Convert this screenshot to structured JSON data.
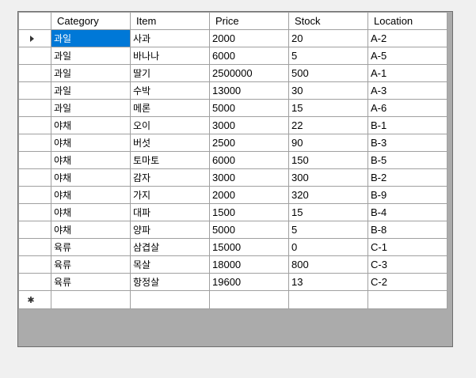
{
  "columns": [
    "Category",
    "Item",
    "Price",
    "Stock",
    "Location"
  ],
  "rows": [
    [
      "과일",
      "사과",
      "2000",
      "20",
      "A-2"
    ],
    [
      "과일",
      "바나나",
      "6000",
      "5",
      "A-5"
    ],
    [
      "과일",
      "딸기",
      "2500000",
      "500",
      "A-1"
    ],
    [
      "과일",
      "수박",
      "13000",
      "30",
      "A-3"
    ],
    [
      "과일",
      "메론",
      "5000",
      "15",
      "A-6"
    ],
    [
      "야채",
      "오이",
      "3000",
      "22",
      "B-1"
    ],
    [
      "야채",
      "버섯",
      "2500",
      "90",
      "B-3"
    ],
    [
      "야채",
      "토마토",
      "6000",
      "150",
      "B-5"
    ],
    [
      "야채",
      "감자",
      "3000",
      "300",
      "B-2"
    ],
    [
      "야채",
      "가지",
      "2000",
      "320",
      "B-9"
    ],
    [
      "야채",
      "대파",
      "1500",
      "15",
      "B-4"
    ],
    [
      "야채",
      "양파",
      "5000",
      "5",
      "B-8"
    ],
    [
      "육류",
      "삼겹살",
      "15000",
      "0",
      "C-1"
    ],
    [
      "육류",
      "목살",
      "18000",
      "800",
      "C-3"
    ],
    [
      "육류",
      "항정살",
      "19600",
      "13",
      "C-2"
    ]
  ],
  "selected_row": 0,
  "selected_col": 0,
  "icons": {
    "current_row": "current-row-arrow-icon",
    "new_row": "new-row-asterisk-icon"
  },
  "colors": {
    "selection": "#0078d7",
    "grid_background": "#ababab",
    "gridline": "#a0a0a0"
  }
}
